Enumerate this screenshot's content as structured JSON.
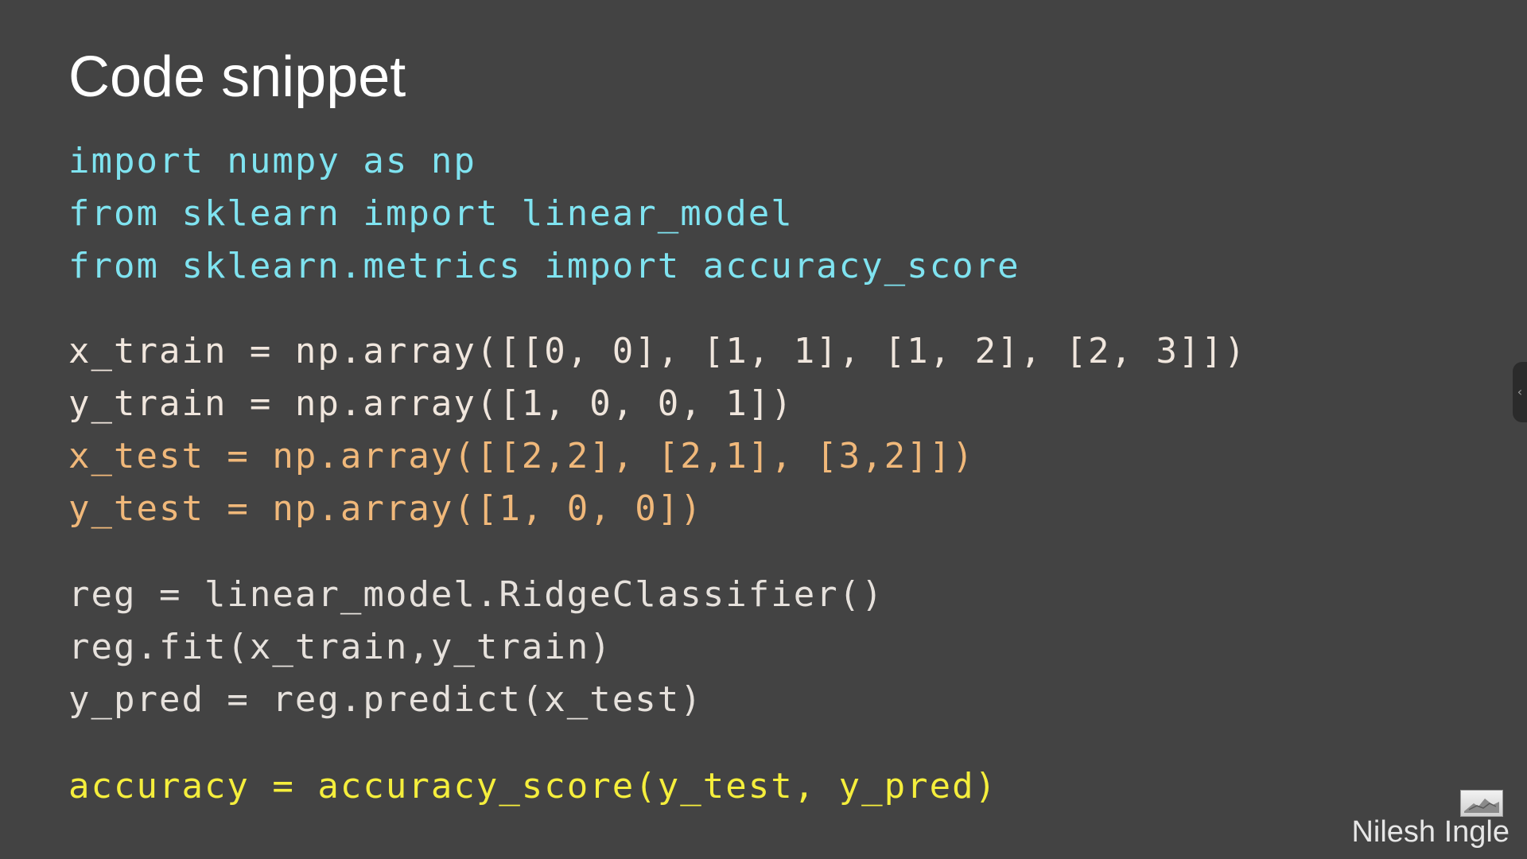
{
  "slide": {
    "title": "Code snippet",
    "author": "Nilesh Ingle",
    "colors": {
      "background": "#434343",
      "import_text": "#7fe3f0",
      "train_text": "#f0e6dd",
      "test_text": "#f0b87a",
      "model_text": "#e6e1dc",
      "accuracy_text": "#f5ee3c"
    }
  },
  "code": {
    "imports": [
      "import numpy as np",
      "from sklearn import linear_model",
      "from sklearn.metrics import accuracy_score"
    ],
    "data": [
      "x_train = np.array([[0, 0], [1, 1], [1, 2], [2, 3]])",
      "y_train = np.array([1, 0, 0, 1])",
      "x_test = np.array([[2,2], [2,1], [3,2]])",
      "y_test = np.array([1, 0, 0])"
    ],
    "model": [
      "reg = linear_model.RidgeClassifier()",
      "reg.fit(x_train,y_train)",
      "y_pred = reg.predict(x_test)"
    ],
    "accuracy": [
      "accuracy = accuracy_score(y_test, y_pred)"
    ]
  },
  "sidebar_toggle": {
    "icon": "chevron-left-icon",
    "glyph": "‹"
  },
  "logo": {
    "icon": "author-logo-image"
  }
}
